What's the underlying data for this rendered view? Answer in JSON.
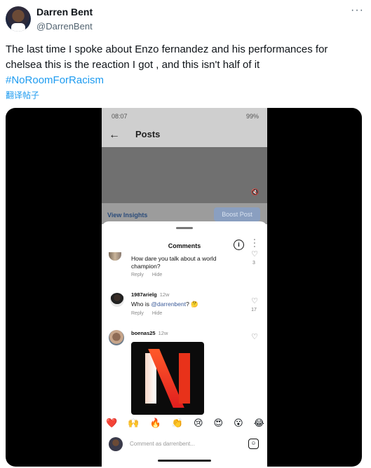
{
  "author": {
    "name": "Darren Bent",
    "handle": "@DarrenBent"
  },
  "tweet": {
    "text": "The last time I spoke about Enzo fernandez and his performances for chelsea this is the reaction I got , and this isn't half of it",
    "hashtag": "#NoRoomForRacism",
    "translate_label": "翻译帖子",
    "more_icon": "more-horizontal-icon"
  },
  "phone": {
    "status_time": "08:07",
    "status_icons_right": "99%",
    "page_title": "Posts",
    "view_insights": "View Insights",
    "boost_post": "Boost Post",
    "comments_title": "Comments",
    "comments": [
      {
        "username": "",
        "time": "",
        "text": "How dare you talk about a world champion?",
        "reply": "Reply",
        "hide": "Hide",
        "likes": "3"
      },
      {
        "username": "1987arielg",
        "time": "12w",
        "text_prefix": "Who is ",
        "mention": "@darrenbent",
        "text_suffix": "? 🤔",
        "reply": "Reply",
        "hide": "Hide",
        "likes": "17"
      },
      {
        "username": "boenas25",
        "time": "12w",
        "text": "",
        "likes": ""
      }
    ],
    "emojis": [
      "❤️",
      "🙌",
      "🔥",
      "👏",
      "😢",
      "😍",
      "😮",
      "😂"
    ],
    "compose_placeholder": "Comment as darrenbent..."
  }
}
